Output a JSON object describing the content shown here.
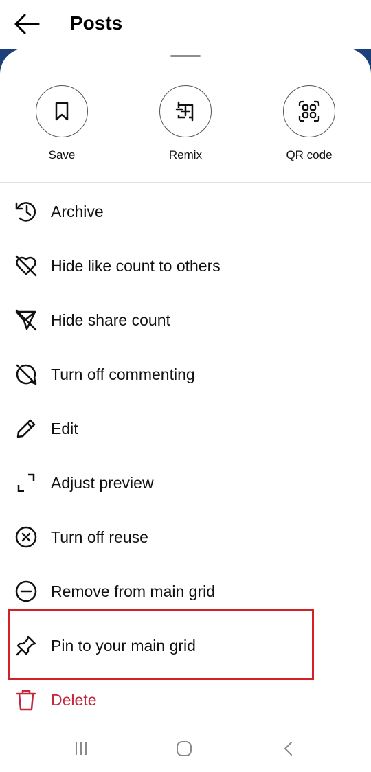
{
  "header": {
    "title": "Posts"
  },
  "quick_actions": [
    {
      "label": "Save",
      "icon": "bookmark-icon"
    },
    {
      "label": "Remix",
      "icon": "remix-icon"
    },
    {
      "label": "QR code",
      "icon": "qr-code-icon"
    }
  ],
  "menu": [
    {
      "label": "Archive",
      "icon": "archive-icon"
    },
    {
      "label": "Hide like count to others",
      "icon": "hide-like-icon"
    },
    {
      "label": "Hide share count",
      "icon": "hide-share-icon"
    },
    {
      "label": "Turn off commenting",
      "icon": "comment-off-icon"
    },
    {
      "label": "Edit",
      "icon": "pencil-icon"
    },
    {
      "label": "Adjust preview",
      "icon": "crop-icon"
    },
    {
      "label": "Turn off reuse",
      "icon": "circle-x-icon"
    },
    {
      "label": "Remove from main grid",
      "icon": "circle-minus-icon"
    },
    {
      "label": "Pin to your main grid",
      "icon": "pin-icon"
    },
    {
      "label": "Delete",
      "icon": "trash-icon"
    }
  ],
  "colors": {
    "danger": "#c4283c",
    "highlight": "#d42027",
    "banner_blue": "#1d3f7a"
  },
  "navbar": [
    "recent-apps-icon",
    "home-icon",
    "back-nav-icon"
  ]
}
